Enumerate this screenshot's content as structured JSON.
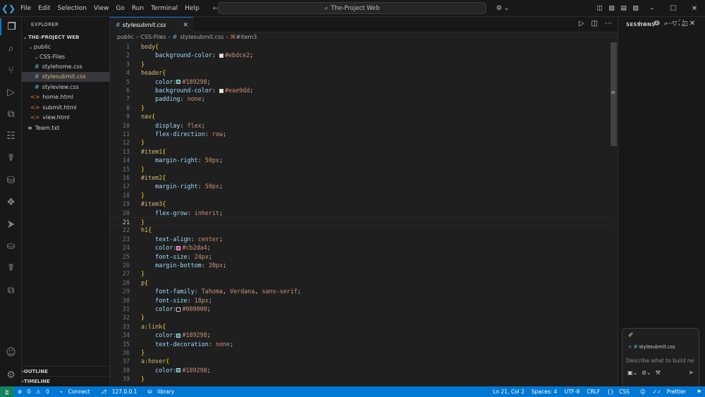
{
  "menu": [
    "File",
    "Edit",
    "Selection",
    "View",
    "Go",
    "Run",
    "Terminal",
    "Help"
  ],
  "search_box": "The-Project Web",
  "explorer": {
    "title": "EXPLORER",
    "root": "THE-PROJECT WEB",
    "public": "public",
    "css_folder": "CSS-Files",
    "css_files": [
      "stylehome.css",
      "stylesubmit.css",
      "styleview.css"
    ],
    "html_files": [
      "home.html",
      "submit.html",
      "view.html"
    ],
    "txt_file": "Team.txt",
    "outline": "OUTLINE",
    "timeline": "TIMELINE"
  },
  "tab": {
    "label": "stylesubmit.css"
  },
  "breadcrumb": [
    "public",
    "CSS-Files",
    "stylesubmit.css",
    "#item3"
  ],
  "code_lines": [
    [
      [
        "sel",
        "body"
      ],
      [
        "br",
        "{"
      ]
    ],
    [
      [
        "pr",
        "    background-color"
      ],
      [
        "pu",
        ": "
      ],
      [
        "sw",
        "#ebdce2"
      ],
      [
        "va",
        "#ebdce2"
      ],
      [
        "pu",
        ";"
      ]
    ],
    [
      [
        "br",
        "}"
      ]
    ],
    [
      [
        "sel",
        "header"
      ],
      [
        "br",
        "{"
      ]
    ],
    [
      [
        "pr",
        "    color"
      ],
      [
        "pu",
        ":"
      ],
      [
        "sw",
        "#189298"
      ],
      [
        "va",
        "#189298"
      ],
      [
        "pu",
        ";"
      ]
    ],
    [
      [
        "pr",
        "    background-color"
      ],
      [
        "pu",
        ": "
      ],
      [
        "sw",
        "#eae9dd"
      ],
      [
        "va",
        "#eae9dd"
      ],
      [
        "pu",
        ";"
      ]
    ],
    [
      [
        "pr",
        "    padding"
      ],
      [
        "pu",
        ": "
      ],
      [
        "va",
        "none"
      ],
      [
        "pu",
        ";"
      ]
    ],
    [
      [
        "br",
        "}"
      ]
    ],
    [
      [
        "sel",
        "nav"
      ],
      [
        "br",
        "{"
      ]
    ],
    [
      [
        "pr",
        "    display"
      ],
      [
        "pu",
        ": "
      ],
      [
        "va",
        "flex"
      ],
      [
        "pu",
        ";"
      ]
    ],
    [
      [
        "pr",
        "    flex-direction"
      ],
      [
        "pu",
        ": "
      ],
      [
        "va",
        "row"
      ],
      [
        "pu",
        ";"
      ]
    ],
    [
      [
        "br",
        "}"
      ]
    ],
    [
      [
        "sel",
        "#item1"
      ],
      [
        "br",
        "{"
      ]
    ],
    [
      [
        "pr",
        "    margin-right"
      ],
      [
        "pu",
        ": "
      ],
      [
        "va",
        "50px"
      ],
      [
        "pu",
        ";"
      ]
    ],
    [
      [
        "br",
        "}"
      ]
    ],
    [
      [
        "sel",
        "#item2"
      ],
      [
        "br",
        "{"
      ]
    ],
    [
      [
        "pr",
        "    margin-right"
      ],
      [
        "pu",
        ": "
      ],
      [
        "va",
        "50px"
      ],
      [
        "pu",
        ";"
      ]
    ],
    [
      [
        "br",
        "}"
      ]
    ],
    [
      [
        "sel",
        "#item3"
      ],
      [
        "br",
        "{"
      ]
    ],
    [
      [
        "pr",
        "    flex-grow"
      ],
      [
        "pu",
        ": "
      ],
      [
        "va",
        "inherit"
      ],
      [
        "pu",
        ";"
      ]
    ],
    [
      [
        "br",
        "}"
      ]
    ],
    [
      [
        "sel",
        "h1"
      ],
      [
        "br",
        "{"
      ]
    ],
    [
      [
        "pr",
        "    text-align"
      ],
      [
        "pu",
        ": "
      ],
      [
        "va",
        "center"
      ],
      [
        "pu",
        ";"
      ]
    ],
    [
      [
        "pr",
        "    color"
      ],
      [
        "pu",
        ":"
      ],
      [
        "sw",
        "#cb2da4"
      ],
      [
        "va",
        "#cb2da4"
      ],
      [
        "pu",
        ";"
      ]
    ],
    [
      [
        "pr",
        "    font-size"
      ],
      [
        "pu",
        ": "
      ],
      [
        "va",
        "24px"
      ],
      [
        "pu",
        ";"
      ]
    ],
    [
      [
        "pr",
        "    margin-bottom"
      ],
      [
        "pu",
        ": "
      ],
      [
        "va",
        "20px"
      ],
      [
        "pu",
        ";"
      ]
    ],
    [
      [
        "br",
        "}"
      ]
    ],
    [
      [
        "sel",
        "p"
      ],
      [
        "br",
        "{"
      ]
    ],
    [
      [
        "pr",
        "    font-family"
      ],
      [
        "pu",
        ": "
      ],
      [
        "va",
        "Tahoma"
      ],
      [
        "pu",
        ", "
      ],
      [
        "va",
        "Verdana"
      ],
      [
        "pu",
        ", "
      ],
      [
        "va",
        "sans-serif"
      ],
      [
        "pu",
        ";"
      ]
    ],
    [
      [
        "pr",
        "    font-size"
      ],
      [
        "pu",
        ": "
      ],
      [
        "va",
        "18px"
      ],
      [
        "pu",
        ";"
      ]
    ],
    [
      [
        "pr",
        "    color"
      ],
      [
        "pu",
        ":"
      ],
      [
        "sw",
        "#000000"
      ],
      [
        "va",
        "#000000"
      ],
      [
        "pu",
        ";"
      ]
    ],
    [
      [
        "br",
        "}"
      ]
    ],
    [
      [
        "sel",
        "a:link"
      ],
      [
        "br",
        "{"
      ]
    ],
    [
      [
        "pr",
        "    color"
      ],
      [
        "pu",
        ":"
      ],
      [
        "sw",
        "#189298"
      ],
      [
        "va",
        "#189298"
      ],
      [
        "pu",
        ";"
      ]
    ],
    [
      [
        "pr",
        "    text-decoration"
      ],
      [
        "pu",
        ": "
      ],
      [
        "va",
        "none"
      ],
      [
        "pu",
        ";"
      ]
    ],
    [
      [
        "br",
        "}"
      ]
    ],
    [
      [
        "sel",
        "a:hover"
      ],
      [
        "br",
        "{"
      ]
    ],
    [
      [
        "pr",
        "    color"
      ],
      [
        "pu",
        ":"
      ],
      [
        "sw",
        "#189298"
      ],
      [
        "va",
        "#189298"
      ],
      [
        "pu",
        ";"
      ]
    ],
    [
      [
        "br",
        "}"
      ]
    ]
  ],
  "current_line": 21,
  "sessions": {
    "title": "SESSIONS",
    "file_chip": "stylesubmit.css",
    "placeholder": "Describe what to build ne"
  },
  "status": {
    "errors": "0",
    "warnings": "0",
    "connect": "Connect",
    "ip": "127.0.0.1",
    "library": "library",
    "position": "Ln 21, Col 2",
    "spaces": "Spaces: 4",
    "encoding": "UTF-8",
    "eol": "CRLF",
    "language": "CSS",
    "prettier": "Prettier"
  }
}
